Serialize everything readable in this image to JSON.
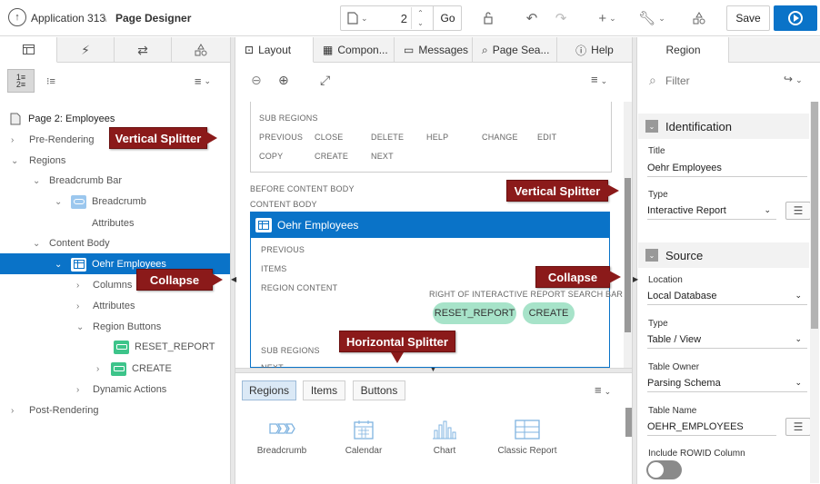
{
  "header": {
    "app_name": "Application 313",
    "separator": "\\",
    "page_designer": "Page Designer",
    "page_number": "2",
    "go_label": "Go",
    "save_label": "Save"
  },
  "left": {
    "tree": {
      "page": "Page 2: Employees",
      "pre_rendering": "Pre-Rendering",
      "regions": "Regions",
      "breadcrumb_bar": "Breadcrumb Bar",
      "breadcrumb": "Breadcrumb",
      "attributes_1": "Attributes",
      "content_body": "Content Body",
      "oehr_employees": "Oehr Employees",
      "columns": "Columns",
      "attributes_2": "Attributes",
      "region_buttons": "Region Buttons",
      "reset_report": "RESET_REPORT",
      "create": "CREATE",
      "dynamic_actions": "Dynamic Actions",
      "post_rendering": "Post-Rendering"
    }
  },
  "middle": {
    "tabs": [
      "Layout",
      "Compon...",
      "Messages",
      "Page Sea...",
      "Help"
    ],
    "sub_regions": "SUB REGIONS",
    "button_positions_row1": [
      "PREVIOUS",
      "CLOSE",
      "DELETE",
      "HELP",
      "CHANGE",
      "EDIT"
    ],
    "button_positions_row2": [
      "COPY",
      "CREATE",
      "NEXT"
    ],
    "before_content_body": "BEFORE CONTENT BODY",
    "content_body": "CONTENT BODY",
    "region_title": "Oehr Employees",
    "region_previous": "PREVIOUS",
    "region_items": "ITEMS",
    "region_content": "REGION CONTENT",
    "right_of_ir": "RIGHT OF INTERACTIVE REPORT SEARCH BAR",
    "chip_reset": "RESET_REPORT",
    "chip_create": "CREATE",
    "region_sub_regions": "SUB REGIONS",
    "region_next": "NEXT",
    "gallery_tabs": [
      "Regions",
      "Items",
      "Buttons"
    ],
    "gallery_items": [
      "Breadcrumb",
      "Calendar",
      "Chart",
      "Classic Report"
    ]
  },
  "right": {
    "tab": "Region",
    "filter_placeholder": "Filter",
    "identification": "Identification",
    "title_label": "Title",
    "title_value": "Oehr Employees",
    "type_label": "Type",
    "type_value": "Interactive Report",
    "source": "Source",
    "location_label": "Location",
    "location_value": "Local Database",
    "source_type_label": "Type",
    "source_type_value": "Table / View",
    "table_owner_label": "Table Owner",
    "table_owner_value": "Parsing Schema",
    "table_name_label": "Table Name",
    "table_name_value": "OEHR_EMPLOYEES",
    "include_rowid_label": "Include ROWID Column",
    "include_rowid_checked": false
  },
  "callouts": {
    "vertical_splitter_left": "Vertical Splitter",
    "vertical_splitter_right": "Vertical Splitter",
    "collapse_left": "Collapse",
    "collapse_right": "Collapse",
    "horizontal_splitter": "Horizontal Splitter"
  },
  "colors": {
    "primary_blue": "#0a73c8",
    "callout_red": "#8b1a1a",
    "chip_green": "#a7e3c9"
  }
}
